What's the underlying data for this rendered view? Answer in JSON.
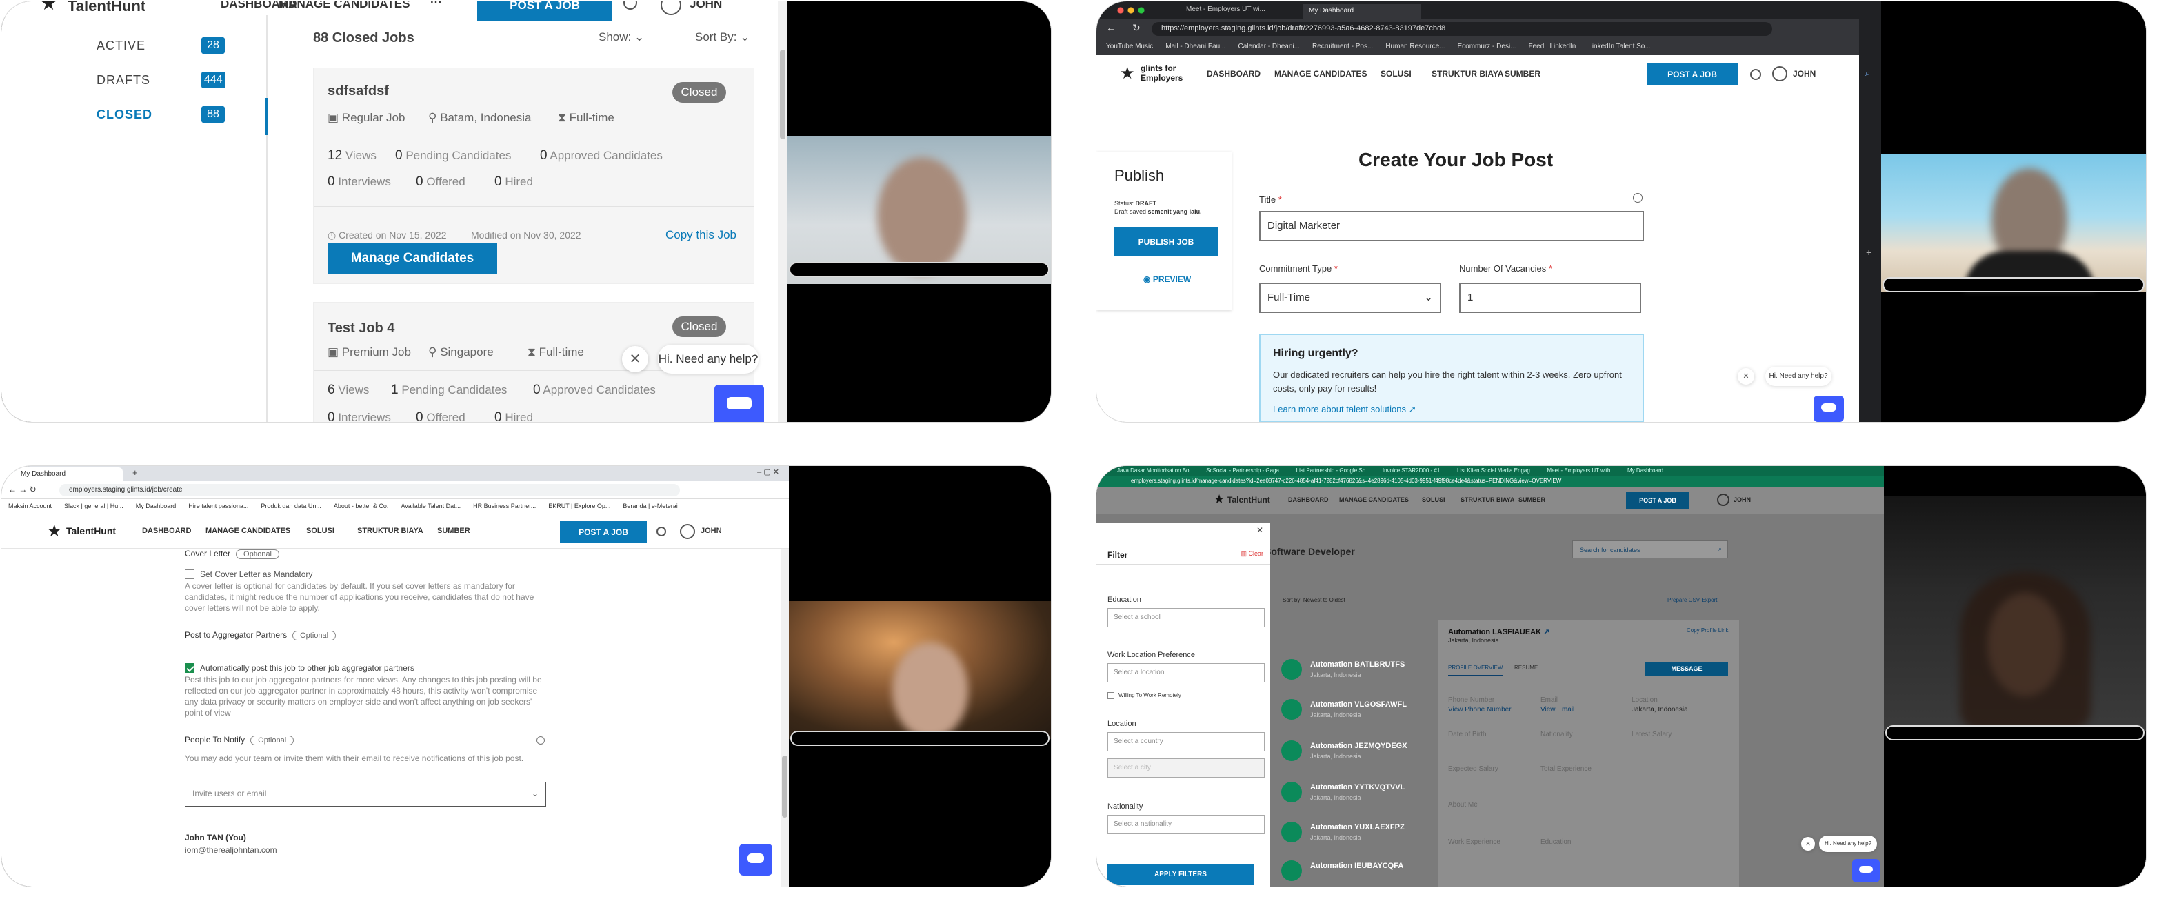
{
  "p1": {
    "brand": "TalentHunt",
    "nav": [
      "DASHBOARD",
      "MANAGE CANDIDATES",
      "···"
    ],
    "post": "POST A JOB",
    "user": "JOHN",
    "sidebar": [
      {
        "label": "ACTIVE",
        "count": "28"
      },
      {
        "label": "DRAFTS",
        "count": "444"
      },
      {
        "label": "CLOSED",
        "count": "88"
      }
    ],
    "list_title": "88 Closed Jobs",
    "show": "Show:",
    "sort": "Sort By:",
    "card1": {
      "title": "sdfsafdsf",
      "type": "Regular Job",
      "location": "Batam, Indonesia",
      "time": "Full-time",
      "status": "Closed",
      "stats": [
        [
          "12",
          "Views"
        ],
        [
          "0",
          "Pending Candidates"
        ],
        [
          "0",
          "Approved Candidates"
        ],
        [
          "0",
          "Interviews"
        ],
        [
          "0",
          "Offered"
        ],
        [
          "0",
          "Hired"
        ]
      ],
      "created": "Created on Nov 15, 2022",
      "modified": "Modified on Nov 30, 2022",
      "copy": "Copy this Job",
      "manage": "Manage Candidates"
    },
    "card2": {
      "title": "Test Job 4",
      "type": "Premium Job",
      "location": "Singapore",
      "time": "Full-time",
      "status": "Closed",
      "stats": [
        [
          "6",
          "Views"
        ],
        [
          "1",
          "Pending Candidates"
        ],
        [
          "0",
          "Approved Candidates"
        ],
        [
          "0",
          "Interviews"
        ],
        [
          "0",
          "Offered"
        ],
        [
          "0",
          "Hired"
        ]
      ]
    },
    "help": "Hi. Need any help?"
  },
  "p2": {
    "tabs": [
      "Meet - Employers UT wi...",
      "My Dashboard"
    ],
    "url": "https://employers.staging.glints.id/job/draft/2276993-a5a6-4682-8743-83197de7cbd8",
    "bookmarks": [
      "YouTube Music",
      "Mail - Dheani Fau...",
      "Calendar - Dheani...",
      "Recruitment - Pos...",
      "Human Resource...",
      "Ecommurz - Desi...",
      "Feed | LinkedIn",
      "LinkedIn Talent So..."
    ],
    "brand1": "glints for",
    "brand2": "Employers",
    "nav": [
      "DASHBOARD",
      "MANAGE CANDIDATES",
      "SOLUSI",
      "STRUKTUR BIAYA",
      "SUMBER"
    ],
    "post": "POST A JOB",
    "user": "JOHN",
    "heading": "Create Your Job Post",
    "publish_title": "Publish",
    "status_label": "Status:",
    "status": "DRAFT",
    "saved_label": "Draft saved",
    "saved": "semenit yang lalu.",
    "publish_btn": "PUBLISH JOB",
    "preview": "PREVIEW",
    "title_label": "Title",
    "title_value": "Digital Marketer",
    "commit_label": "Commitment Type",
    "commit_value": "Full-Time",
    "vac_label": "Number Of Vacancies",
    "vac_value": "1",
    "urgent_title": "Hiring urgently?",
    "urgent_text": "Our dedicated recruiters can help you hire the right talent within 2-3 weeks. Zero upfront costs, only pay for results!",
    "urgent_link": "Learn more about talent solutions",
    "help": "Hi. Need any help?"
  },
  "p3": {
    "tab": "My Dashboard",
    "url": "employers.staging.glints.id/job/create",
    "bookmarks": [
      "Maksin Account",
      "Slack | general | Hu...",
      "My Dashboard",
      "Hire talent passiona...",
      "Produk dan data Un...",
      "About - better & Co.",
      "Available Talent Dat...",
      "HR Business Partner...",
      "EKRUT | Explore Op...",
      "Beranda | e-Meterai"
    ],
    "brand": "TalentHunt",
    "nav": [
      "DASHBOARD",
      "MANAGE CANDIDATES",
      "SOLUSI",
      "STRUKTUR BIAYA",
      "SUMBER"
    ],
    "post": "POST A JOB",
    "user": "JOHN",
    "cover": "Cover Letter",
    "optional": "Optional",
    "cover_check": "Set Cover Letter as Mandatory",
    "cover_desc": "A cover letter is optional for candidates by default. If you set cover letters as mandatory for candidates, it might reduce the number of applications you receive, candidates that do not have cover letters will not be able to apply.",
    "agg": "Post to Aggregator Partners",
    "agg_check": "Automatically post this job to other job aggregator partners",
    "agg_desc": "Post this job to our job aggregator partners for more views. Any changes to this job posting will be reflected on our job aggregator partner in approximately 48 hours, this activity won't compromise any data privacy or security matters on employer side and won't affect anything on job seekers' point of view",
    "notify": "People To Notify",
    "notify_desc": "You may add your team or invite them with their email to receive notifications of this job post.",
    "invite": "Invite users or email",
    "person": "John TAN (You)",
    "email": "iom@therealjohntan.com"
  },
  "p4": {
    "tabs": [
      "Java Dasar Monitorisation Bo...",
      "ScSocial - Partnership - Gaga...",
      "List Partnership - Google Sh...",
      "Invoice STAR2D00 - #1...",
      "List Klien Social Media Engag...",
      "Meet - Employers UT with...",
      "My Dashboard"
    ],
    "url": "employers.staging.glints.id/manage-candidates?id=2ee08747-c226-4854-af41-7282cf476826&s=4e2896d-4105-4d03-9951-f49f98ce4de4&status=PENDING&view=OVERVIEW",
    "brand": "TalentHunt",
    "nav": [
      "DASHBOARD",
      "MANAGE CANDIDATES",
      "SOLUSI",
      "STRUKTUR BIAYA",
      "SUMBER"
    ],
    "post": "POST A JOB",
    "user": "JOHN",
    "job": "Software Developer",
    "search": "Search for candidates",
    "filter": "Filter",
    "clear": "Clear",
    "education": "Education",
    "edu_ph": "Select a school",
    "wlp": "Work Location Preference",
    "wlp_ph": "Select a location",
    "remote": "Willing To Work Remotely",
    "location": "Location",
    "loc_ph": "Select a country",
    "city_ph": "Select a city",
    "nationality": "Nationality",
    "nat_ph": "Select a nationality",
    "apply": "APPLY FILTERS",
    "candidates": [
      {
        "name": "Automation BATLBRUTFS",
        "loc": "Jakarta, Indonesia"
      },
      {
        "name": "Automation VLGOSFAWFL",
        "loc": "Jakarta, Indonesia"
      },
      {
        "name": "Automation JEZMQYDEGX",
        "loc": "Jakarta, Indonesia"
      },
      {
        "name": "Automation YYTKVQTVVL",
        "loc": "Jakarta, Indonesia"
      },
      {
        "name": "Automation YUXLAEXFPZ",
        "loc": "Jakarta, Indonesia"
      },
      {
        "name": "Automation IEUBAYCQFA",
        "loc": ""
      }
    ],
    "detail_name": "Automation LASFIAUEAK",
    "detail_loc": "Jakarta, Indonesia",
    "copy_link": "Copy Profile Link",
    "tab_profile": "PROFILE OVERVIEW",
    "tab_resume": "RESUME",
    "message": "MESSAGE",
    "phone": "Phone Number",
    "phone_v": "View Phone Number",
    "email": "Email",
    "email_v": "View Email",
    "loclbl": "Location",
    "loc_v": "Jakarta, Indonesia",
    "dob": "Date of Birth",
    "nat": "Nationality",
    "salary": "Latest Salary",
    "exp_salary": "Expected Salary",
    "total_exp": "Total Experience",
    "about": "About Me",
    "work_exp": "Work Experience",
    "edu2": "Education",
    "help": "Hi. Need any help?",
    "sort": "Sort by:",
    "sort_v": "Newest to Oldest",
    "export": "Prepare CSV Export"
  }
}
